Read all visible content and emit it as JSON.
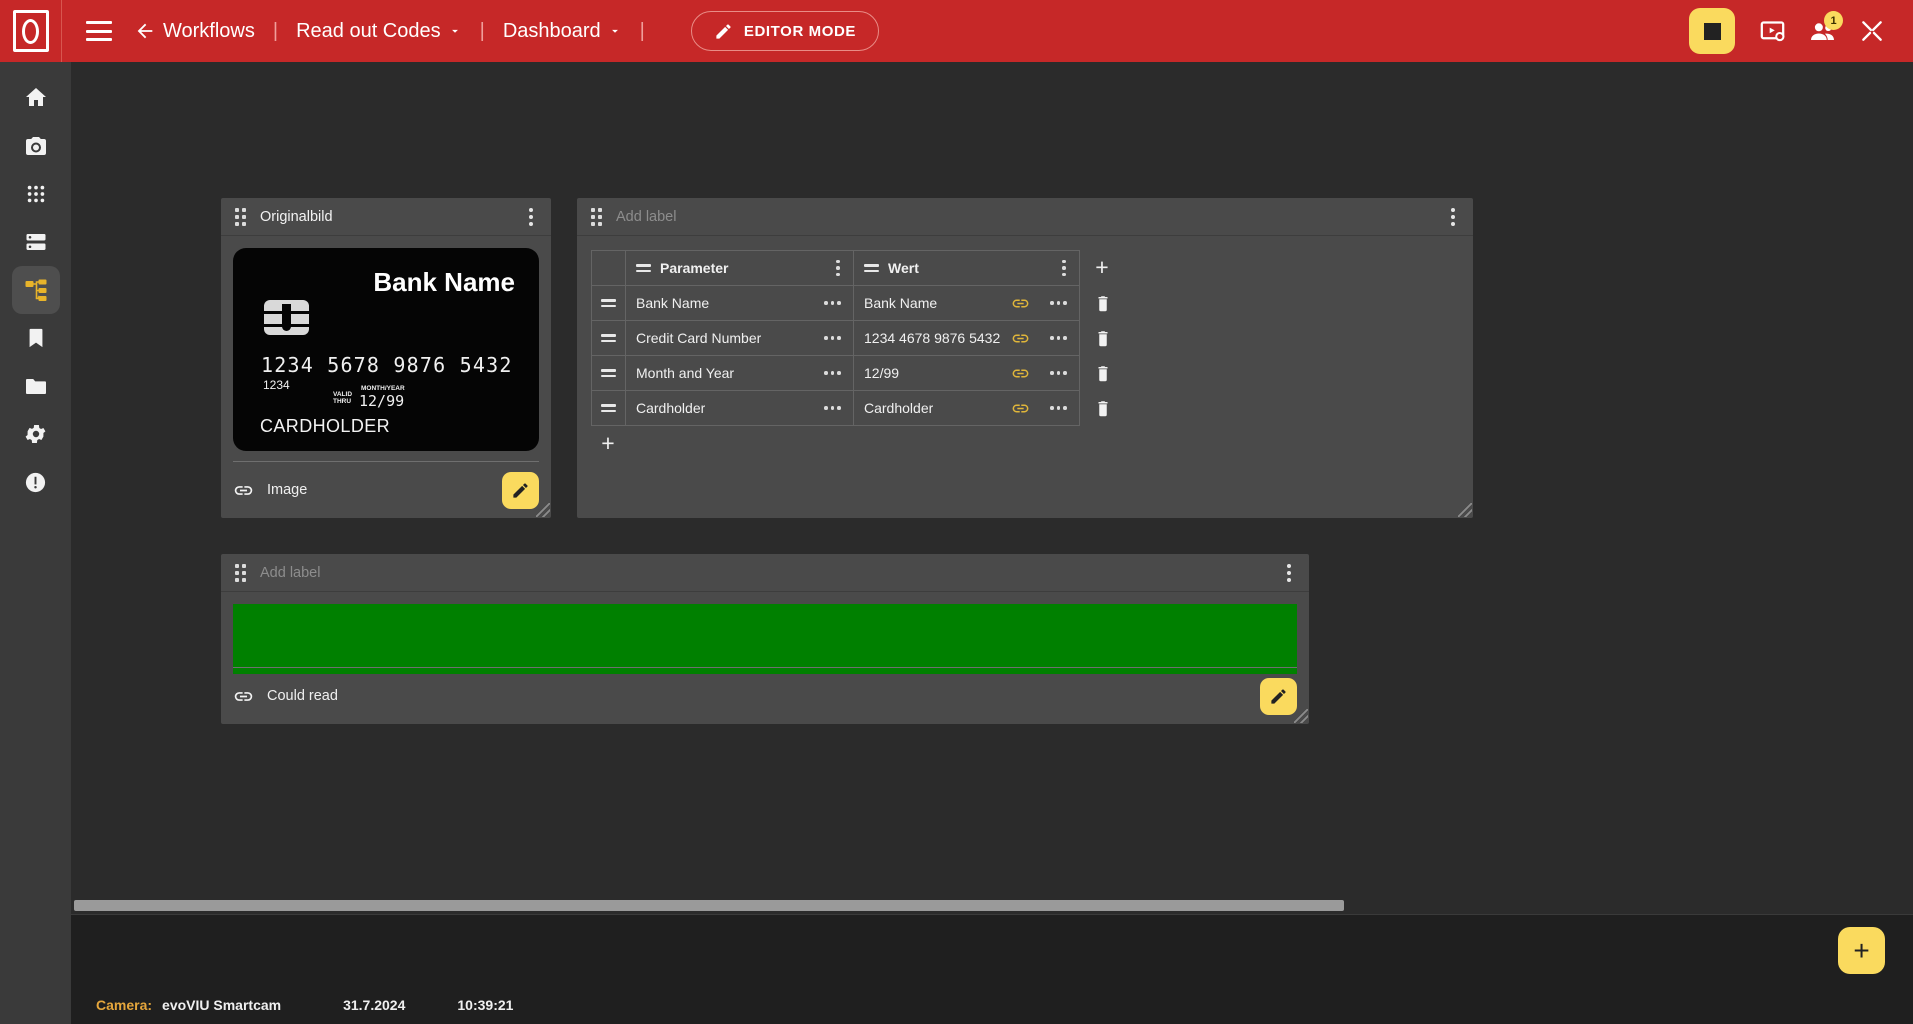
{
  "topbar": {
    "logo_alt": "evoVIU logo",
    "menu_icon": "hamburger-menu-icon",
    "back_icon": "arrow-left-icon",
    "breadcrumb": [
      {
        "label": "Workflows",
        "icon": "arrow-left-icon",
        "has_caret": false
      },
      {
        "label": "Read out Codes",
        "icon": "",
        "has_caret": true
      },
      {
        "label": "Dashboard",
        "icon": "",
        "has_caret": true
      }
    ],
    "separator": "|",
    "editor_button": {
      "label": "EDITOR MODE",
      "icon": "pencil-icon"
    },
    "actions": [
      {
        "name": "stop-button",
        "icon": "stop-square-icon"
      },
      {
        "name": "screen-settings-button",
        "icon": "screen-settings-icon"
      },
      {
        "name": "users-button",
        "icon": "people-icon",
        "badge": "1"
      },
      {
        "name": "disconnect-button",
        "icon": "tools-disconnect-icon"
      }
    ],
    "accent_red": "#c62828",
    "accent_yellow": "#fada5e"
  },
  "sidebar": {
    "items": [
      {
        "name": "sidebar-item-home",
        "icon": "home-icon",
        "active": false
      },
      {
        "name": "sidebar-item-camera",
        "icon": "camera-icon",
        "active": false
      },
      {
        "name": "sidebar-item-apps",
        "icon": "apps-grid-icon",
        "active": false
      },
      {
        "name": "sidebar-item-devices",
        "icon": "server-icon",
        "active": false
      },
      {
        "name": "sidebar-item-workflows",
        "icon": "workflow-icon",
        "active": true
      },
      {
        "name": "sidebar-item-bookmarks",
        "icon": "bookmark-icon",
        "active": false
      },
      {
        "name": "sidebar-item-files",
        "icon": "folder-icon",
        "active": false
      },
      {
        "name": "sidebar-item-settings",
        "icon": "gear-icon",
        "active": false
      },
      {
        "name": "sidebar-item-alerts",
        "icon": "alert-circle-icon",
        "active": false
      }
    ]
  },
  "panels": {
    "original": {
      "title": "Originalbild",
      "drag_icon": "drag-handle-icon",
      "menu_icon": "kebab-menu-icon",
      "footer": {
        "label": "Image",
        "link_icon": "link-icon",
        "edit_icon": "pencil-icon"
      },
      "card": {
        "bank_name": "Bank Name",
        "number": "1234 5678 9876 5432",
        "sub_number": "1234",
        "valid_thru_line1": "VALID",
        "valid_thru_line2": "THRU",
        "month_year_label": "MONTH/YEAR",
        "expiry": "12/99",
        "cardholder": "CARDHOLDER"
      }
    },
    "table": {
      "title_placeholder": "Add label",
      "drag_icon": "drag-handle-icon",
      "menu_icon": "kebab-menu-icon",
      "columns": [
        {
          "label": "Parameter",
          "icon": "equals-icon"
        },
        {
          "label": "Wert",
          "icon": "equals-icon"
        }
      ],
      "add_column_label": "+",
      "add_row_label": "+",
      "rows": [
        {
          "handle_icon": "equals-icon",
          "parameter": "Bank Name",
          "value": "Bank Name",
          "link_icon": "link-icon",
          "row_menu_icon": "dots-menu-icon",
          "delete_icon": "trash-icon"
        },
        {
          "handle_icon": "equals-icon",
          "parameter": "Credit Card Number",
          "value": "1234 4678 9876 5432",
          "link_icon": "link-icon",
          "row_menu_icon": "dots-menu-icon",
          "delete_icon": "trash-icon"
        },
        {
          "handle_icon": "equals-icon",
          "parameter": "Month and Year",
          "value": "12/99",
          "link_icon": "link-icon",
          "row_menu_icon": "dots-menu-icon",
          "delete_icon": "trash-icon"
        },
        {
          "handle_icon": "equals-icon",
          "parameter": "Cardholder",
          "value": "Cardholder",
          "link_icon": "link-icon",
          "row_menu_icon": "dots-menu-icon",
          "delete_icon": "trash-icon"
        }
      ]
    },
    "result": {
      "title_placeholder": "Add label",
      "drag_icon": "drag-handle-icon",
      "menu_icon": "kebab-menu-icon",
      "status_color": "#008000",
      "footer": {
        "label": "Could read",
        "link_icon": "link-icon",
        "edit_icon": "pencil-icon"
      }
    }
  },
  "bottom": {
    "add_button_label": "+",
    "add_button_icon": "plus-icon",
    "status": {
      "camera_key": "Camera:",
      "camera_value": "evoVIU Smartcam",
      "date": "31.7.2024",
      "time": "10:39:21"
    }
  }
}
